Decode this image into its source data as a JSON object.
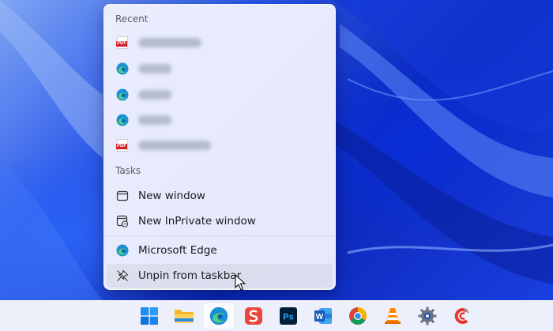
{
  "jumplist": {
    "recent_label": "Recent",
    "recent_items": [
      {
        "icon": "pdf-icon",
        "label": ""
      },
      {
        "icon": "edge-icon",
        "label": ""
      },
      {
        "icon": "edge-icon",
        "label": ""
      },
      {
        "icon": "edge-icon",
        "label": ""
      },
      {
        "icon": "pdf-icon",
        "label": ""
      }
    ],
    "tasks_label": "Tasks",
    "tasks": [
      {
        "icon": "window-icon",
        "label": "New window"
      },
      {
        "icon": "inprivate-window-icon",
        "label": "New InPrivate window"
      }
    ],
    "app": {
      "icon": "edge-icon",
      "label": "Microsoft Edge"
    },
    "unpin": {
      "icon": "unpin-icon",
      "label": "Unpin from taskbar"
    },
    "pdf_badge": "PDF"
  },
  "taskbar": {
    "items": [
      {
        "name": "start-button",
        "icon": "windows-logo-icon"
      },
      {
        "name": "file-explorer",
        "icon": "folder-icon"
      },
      {
        "name": "microsoft-edge",
        "icon": "edge-icon",
        "active": true
      },
      {
        "name": "wps",
        "icon": "wps-s-icon"
      },
      {
        "name": "photoshop",
        "icon": "photoshop-icon"
      },
      {
        "name": "word",
        "icon": "word-icon"
      },
      {
        "name": "chrome",
        "icon": "chrome-icon"
      },
      {
        "name": "vlc",
        "icon": "vlc-cone-icon"
      },
      {
        "name": "settings",
        "icon": "gear-icon"
      },
      {
        "name": "ccleaner",
        "icon": "ccleaner-icon"
      }
    ],
    "ps_text": "Ps",
    "word_text": "W"
  },
  "colors": {
    "accent_blue": "#0b27b8",
    "menu_bg": "#eff1fc",
    "pdf_red": "#d5202a"
  }
}
